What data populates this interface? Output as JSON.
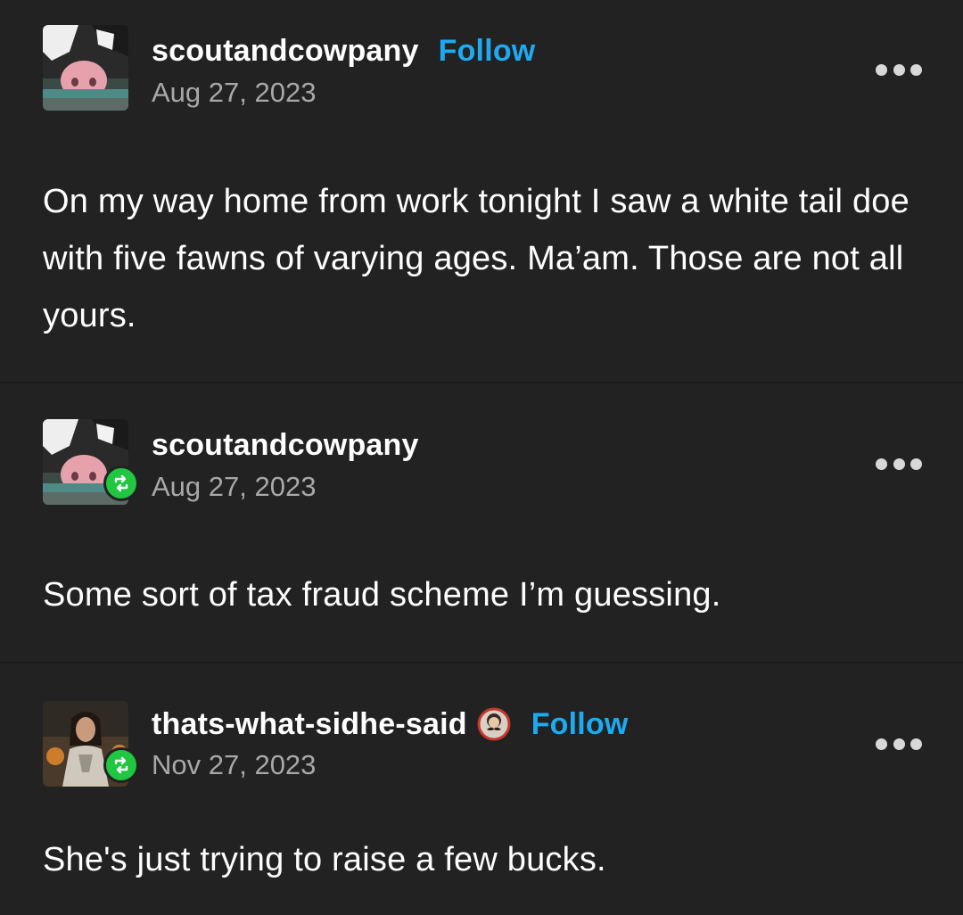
{
  "posts": [
    {
      "username": "scoutandcowpany",
      "follow_label": "Follow",
      "date": "Aug 27, 2023",
      "body": "On my way home from work tonight I saw a white tail doe with five fawns of varying ages. Ma’am. Those are not all yours.",
      "avatar_icon": "cow-avatar",
      "reblogged": false
    },
    {
      "username": "scoutandcowpany",
      "date": "Aug 27, 2023",
      "body": "Some sort of tax fraud scheme I’m guessing.",
      "avatar_icon": "cow-avatar",
      "reblogged": true
    },
    {
      "username": "thats-what-sidhe-said",
      "follow_label": "Follow",
      "date": "Nov 27, 2023",
      "body": "She's just trying to raise a few bucks.",
      "avatar_icon": "woman-avatar",
      "reblogged": true,
      "badge_icon": "mustache-badge-icon"
    }
  ],
  "colors": {
    "background": "#222222",
    "follow": "#1eaaf1",
    "reblog_badge": "#21c641",
    "date": "#a8a8a8"
  },
  "icons": {
    "more": "more-options-icon",
    "reblog": "reblog-icon"
  }
}
